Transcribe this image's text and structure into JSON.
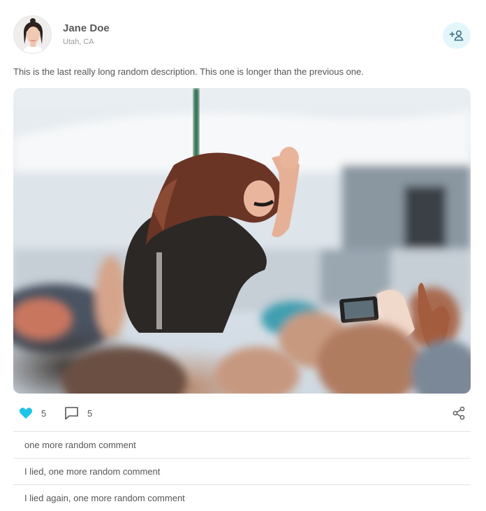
{
  "post": {
    "author_name": "Jane Doe",
    "author_location": "Utah, CA",
    "description": "This is the last really long random description. This one is longer than the previous one.",
    "follow_icon": "add-person-icon",
    "image_subject": "woman-dancing-at-concert-crowd"
  },
  "actions": {
    "likes_count": "5",
    "comments_count": "5",
    "like_icon": "heart-icon",
    "comment_icon": "comment-icon",
    "share_icon": "share-icon",
    "like_color": "#1cc4e8"
  },
  "comments": [
    {
      "text": "one more random comment"
    },
    {
      "text": "I lied, one more random comment"
    },
    {
      "text": "I lied again, one more random comment"
    }
  ]
}
